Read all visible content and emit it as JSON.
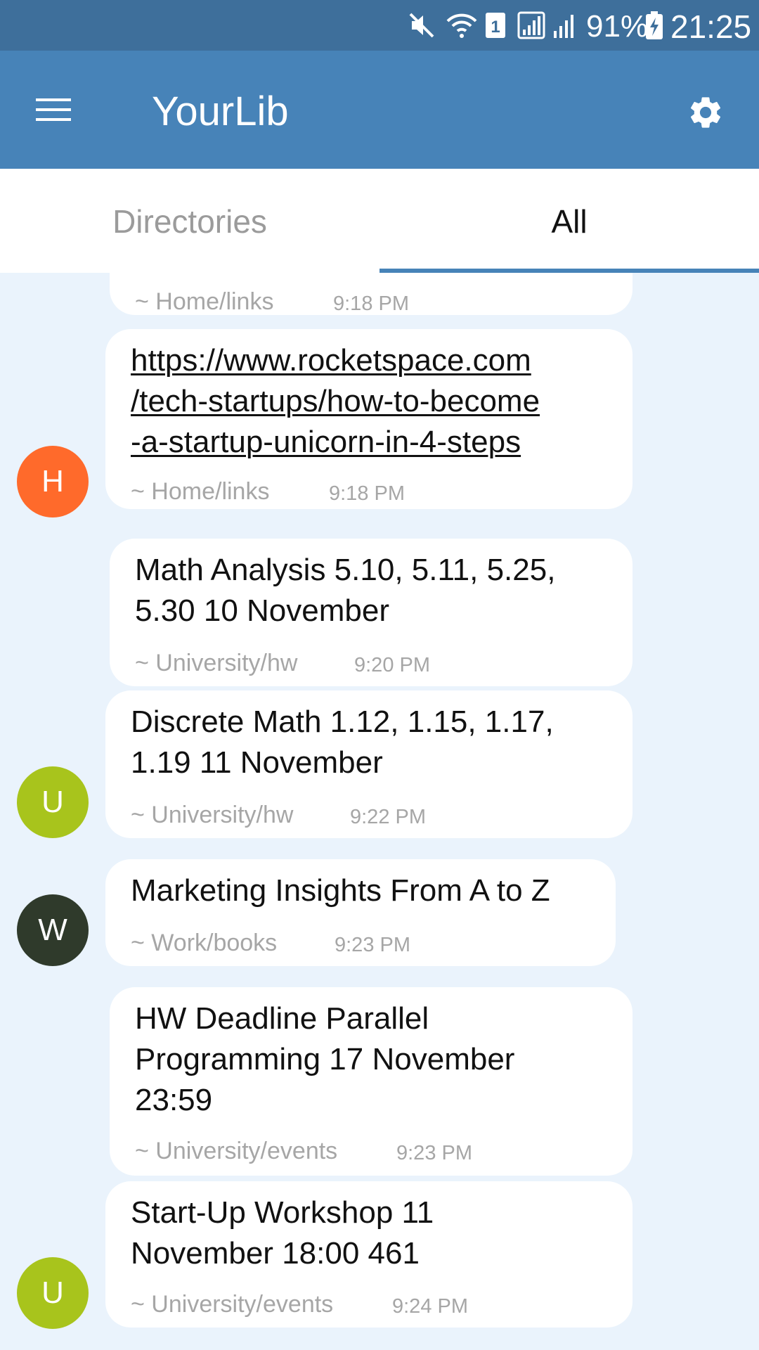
{
  "status_bar": {
    "battery": "91%",
    "clock": "21:25",
    "sim_slot": "1",
    "icons": [
      "mute-icon",
      "wifi-icon",
      "sim-icon",
      "signal-icon",
      "signal-icon",
      "battery-charging-icon"
    ]
  },
  "toolbar": {
    "title": "YourLib",
    "menu_icon": "hamburger-menu-icon",
    "settings_icon": "gear-icon"
  },
  "tabs": [
    {
      "label": "Directories",
      "selected": false
    },
    {
      "label": "All",
      "selected": true
    }
  ],
  "colors": {
    "status_bar": "#3e6f9b",
    "toolbar": "#4783b8",
    "background": "#eaf3fc",
    "avatar_h": "#ff6a2b",
    "avatar_u": "#a8c41c",
    "avatar_w": "#2f3a2b"
  },
  "items": [
    {
      "text": "",
      "path": "~ Home/links",
      "time": "9:18 PM"
    },
    {
      "text": "https://www.rocketspace.com\n/tech-startups/how-to-become\n-a-startup-unicorn-in-4-steps",
      "path": "~ Home/links",
      "time": "9:18 PM",
      "avatar": "H",
      "is_link": true
    },
    {
      "text": "Math Analysis 5.10, 5.11, 5.25,\n5.30 10 November",
      "path": "~ University/hw",
      "time": "9:20 PM"
    },
    {
      "text": "Discrete Math 1.12, 1.15, 1.17,\n1.19 11 November",
      "path": "~ University/hw",
      "time": "9:22 PM",
      "avatar": "U"
    },
    {
      "text": "Marketing Insights From A to Z",
      "path": "~ Work/books",
      "time": "9:23 PM",
      "avatar": "W"
    },
    {
      "text": "HW Deadline Parallel\nProgramming 17 November\n23:59",
      "path": "~ University/events",
      "time": "9:23 PM"
    },
    {
      "text": "Start-Up Workshop 11\nNovember 18:00 461",
      "path": "~ University/events",
      "time": "9:24 PM",
      "avatar": "U"
    }
  ]
}
